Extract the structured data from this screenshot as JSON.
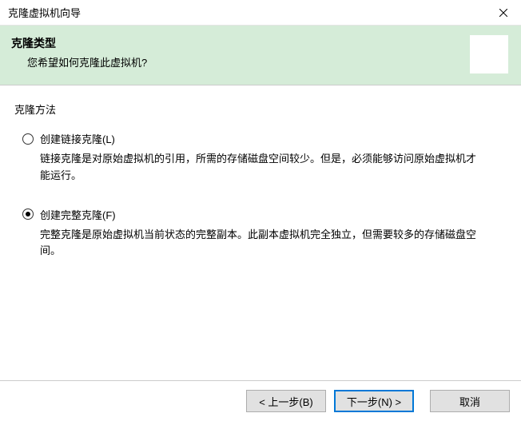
{
  "titlebar": {
    "title": "克隆虚拟机向导"
  },
  "header": {
    "title": "克隆类型",
    "subtitle": "您希望如何克隆此虚拟机?"
  },
  "group": {
    "label": "克隆方法"
  },
  "options": [
    {
      "label": "创建链接克隆(L)",
      "description": "链接克隆是对原始虚拟机的引用，所需的存储磁盘空间较少。但是，必须能够访问原始虚拟机才能运行。",
      "selected": false
    },
    {
      "label": "创建完整克隆(F)",
      "description": "完整克隆是原始虚拟机当前状态的完整副本。此副本虚拟机完全独立，但需要较多的存储磁盘空间。",
      "selected": true
    }
  ],
  "footer": {
    "back": "< 上一步(B)",
    "next": "下一步(N) >",
    "cancel": "取消"
  }
}
